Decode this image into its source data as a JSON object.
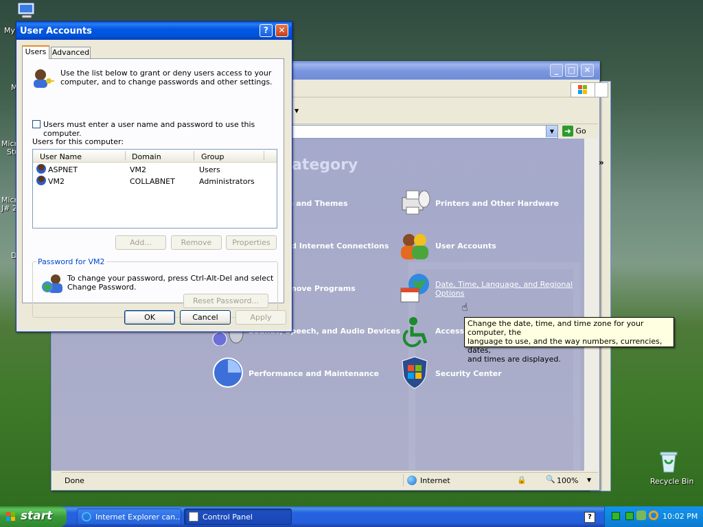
{
  "desktop": {
    "icons": [
      {
        "label": "My",
        "icon": "my-computer-icon"
      },
      {
        "label": "M",
        "icon": "my-documents-icon"
      },
      {
        "label": "Micro",
        "icon": "app-icon"
      },
      {
        "label": "Stu",
        "icon": "app-icon"
      },
      {
        "label": "Micro",
        "icon": "app-icon"
      },
      {
        "label": "J# 2",
        "icon": "app-icon"
      },
      {
        "label": "D",
        "icon": "app-icon"
      }
    ],
    "recycle_bin": "Recycle Bin"
  },
  "control_panel": {
    "heading_fragment": "ategory",
    "go_label": "Go",
    "chevrons": "»",
    "items_left": [
      {
        "label": "e and Themes"
      },
      {
        "label": "d Internet Connections"
      },
      {
        "label": "nove Programs"
      },
      {
        "label": "Sounds, Speech, and Audio Devices"
      },
      {
        "label": "Performance and Maintenance"
      }
    ],
    "items_right": [
      {
        "label": "Printers and Other Hardware"
      },
      {
        "label": "User Accounts"
      },
      {
        "label": "Date, Time, Language, and Regional",
        "label2": "Options"
      },
      {
        "label": "Access"
      },
      {
        "label": "Security Center"
      }
    ],
    "tooltip": [
      "Change the date, time, and time zone for your computer, the",
      "language to use, and the way numbers, currencies, dates,",
      "and times are displayed."
    ],
    "status": {
      "left": "Done",
      "zone": "Internet",
      "zoom": "100%"
    }
  },
  "dialog": {
    "title": "User Accounts",
    "tabs": [
      "Users",
      "Advanced"
    ],
    "intro_line1": "Use the list below to grant or deny users access to your",
    "intro_line2": "computer, and to change passwords and other settings.",
    "checkbox_label": "Users must enter a user name and password to use this computer.",
    "checkbox_checked": false,
    "list_caption": "Users for this computer:",
    "columns": [
      "User Name",
      "Domain",
      "Group"
    ],
    "rows": [
      {
        "name": "ASPNET",
        "domain": "VM2",
        "group": "Users"
      },
      {
        "name": "VM2",
        "domain": "COLLABNET",
        "group": "Administrators"
      }
    ],
    "buttons": {
      "add": "Add...",
      "remove": "Remove",
      "properties": "Properties"
    },
    "password_group_title": "Password for VM2",
    "password_text_1": "To change your password, press Ctrl-Alt-Del and select",
    "password_text_2": "Change Password.",
    "reset_password": "Reset Password...",
    "ok": "OK",
    "cancel": "Cancel",
    "apply": "Apply"
  },
  "taskbar": {
    "start": "start",
    "tasks": [
      "Internet Explorer can...",
      "Control Panel"
    ],
    "clock": "10:02 PM"
  }
}
